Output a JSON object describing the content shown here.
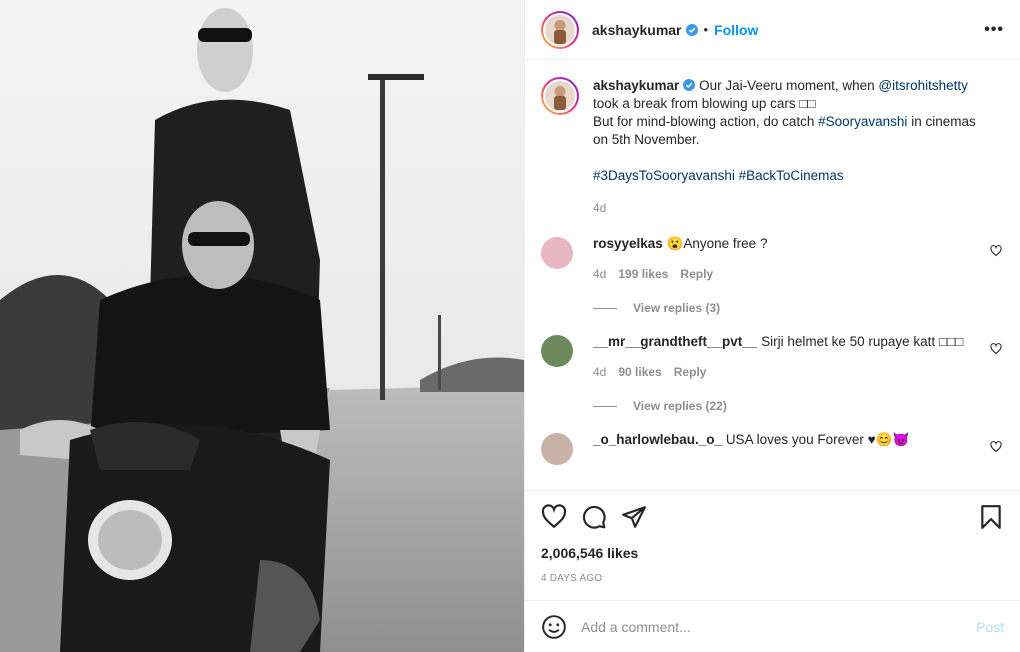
{
  "post": {
    "username": "akshaykumar",
    "follow_label": "Follow",
    "caption_line1_pre": "Our Jai-Veeru moment, when ",
    "caption_mention": "@itsrohitshetty",
    "caption_line1_post": " took a break from blowing up cars □□",
    "caption_line2_pre": "But for mind-blowing action, do catch ",
    "caption_tag1": "#Sooryavanshi",
    "caption_line2_post": " in cinemas on 5th November.",
    "caption_tag2": "#3DaysToSooryavanshi",
    "caption_tag3": "#BackToCinemas",
    "caption_time": "4d"
  },
  "comments": [
    {
      "user": "rosyyelkas",
      "text": "😮Anyone free ?",
      "time": "4d",
      "likes": "199 likes",
      "reply": "Reply",
      "replies": "View replies (3)",
      "avatar_color": "#e9b7c2"
    },
    {
      "user": "__mr__grandtheft__pvt__",
      "text": "Sirji helmet ke 50 rupaye katt □□□",
      "time": "4d",
      "likes": "90 likes",
      "reply": "Reply",
      "replies": "View replies (22)",
      "avatar_color": "#6c8a5e"
    },
    {
      "user": "_o_harlowlebau._o_",
      "text": "USA loves you Forever ♥😊😈",
      "avatar_color": "#c9b2a8"
    }
  ],
  "stats": {
    "likes": "2,006,546 likes",
    "ago": "4 DAYS AGO"
  },
  "composer": {
    "placeholder": "Add a comment...",
    "post_label": "Post"
  },
  "colors": {
    "link": "#00376b",
    "follow": "#0095f6",
    "muted": "#8e8e8e"
  }
}
